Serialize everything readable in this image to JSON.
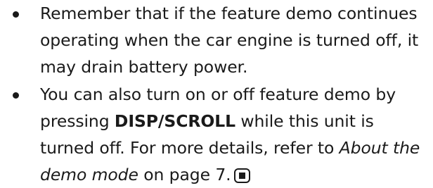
{
  "notes": [
    {
      "text": "Remember that if the feature demo continues operating when the car engine is turned off, it may drain battery power."
    },
    {
      "prefix": "You can also turn on or off feature demo by pressing ",
      "button": "DISP/SCROLL",
      "middle": " while this unit is turned off. For more details, refer to ",
      "link": "About the demo mode",
      "suffix": " on page 7."
    }
  ],
  "icons": {
    "end_mark": "end-of-section-icon"
  }
}
